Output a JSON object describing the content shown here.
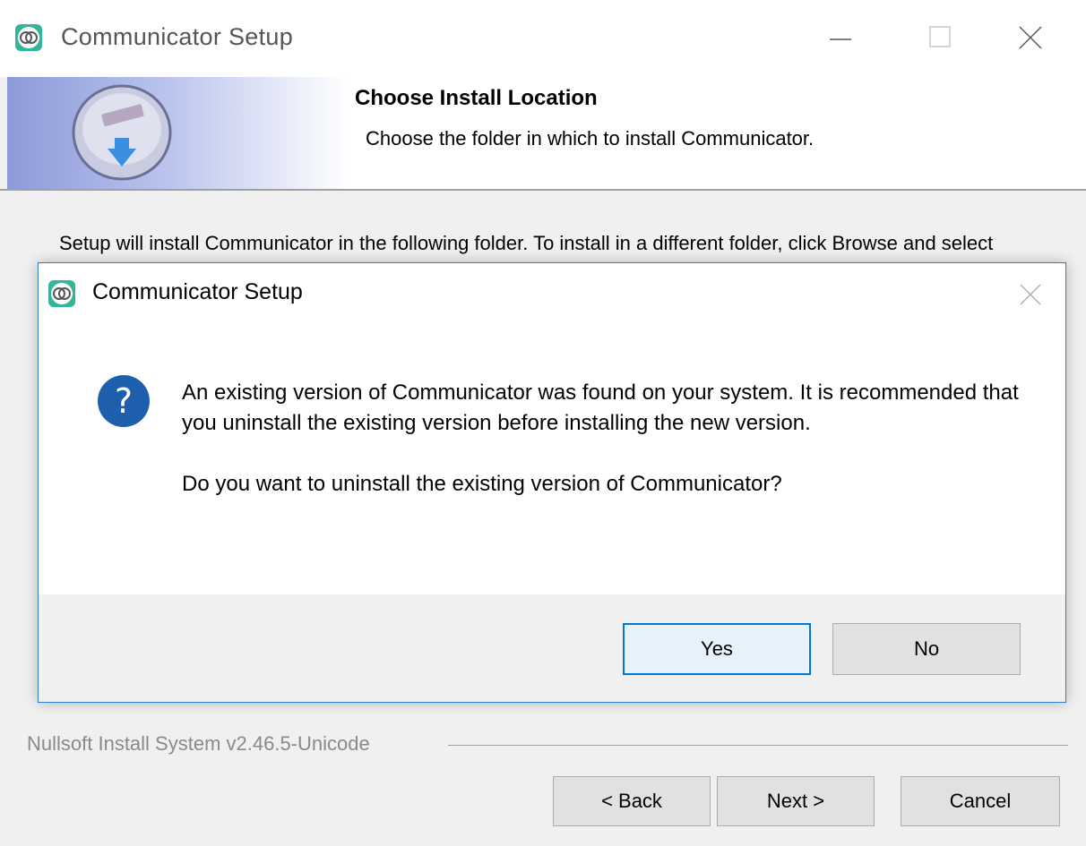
{
  "window": {
    "title": "Communicator Setup",
    "icon": "communicator-app-icon"
  },
  "header": {
    "title": "Choose Install Location",
    "subtitle": "Choose the folder in which to install Communicator.",
    "logo": "installer-disc-icon"
  },
  "body": {
    "text": "Setup will install Communicator in the following folder. To install in a different folder, click Browse and select another folder. Click Next to continue."
  },
  "footer": {
    "brand": "Nullsoft Install System v2.46.5-Unicode",
    "back_label": "< Back",
    "next_label": "Next >",
    "cancel_label": "Cancel"
  },
  "dialog": {
    "title": "Communicator Setup",
    "icon": "question-icon",
    "message": "An existing version of Communicator was found on your system. It is recommended that you uninstall the existing version before installing the new version.",
    "question": "Do you want to uninstall the existing version of Communicator?",
    "yes_label": "Yes",
    "no_label": "No"
  },
  "colors": {
    "accent": "#0078d7",
    "question_icon": "#1e5fad",
    "header_gradient": "#8c9ad8",
    "window_bg": "#f0f0f0"
  }
}
